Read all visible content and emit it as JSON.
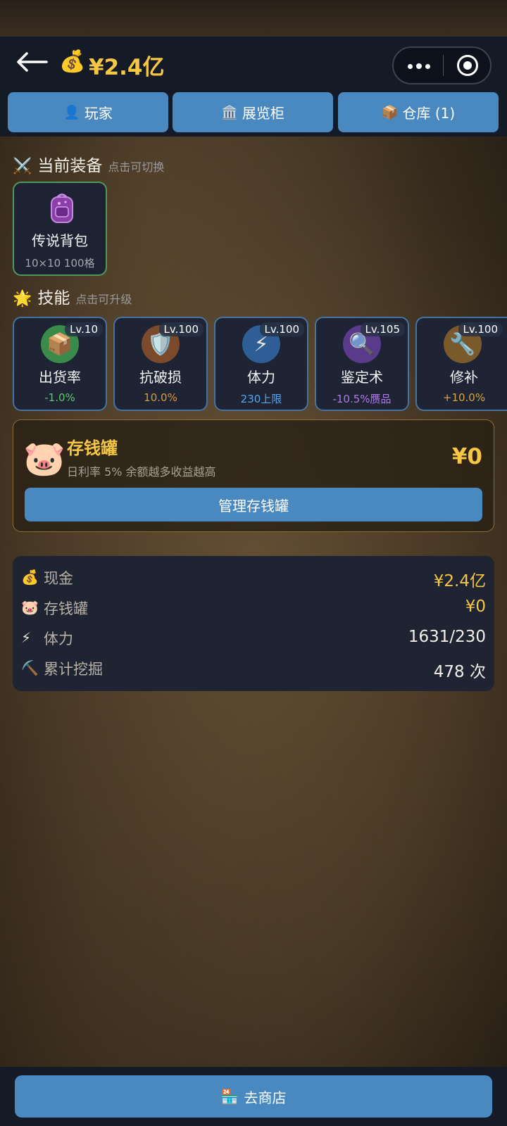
{
  "header": {
    "money_icon": "money-bag-icon",
    "money_value": "¥2.4亿"
  },
  "tabs": [
    {
      "icon": "👤",
      "label": "玩家"
    },
    {
      "icon": "🏛️",
      "label": "展览柜"
    },
    {
      "icon": "📦",
      "label": "仓库 (1)"
    }
  ],
  "equipment": {
    "title": "当前装备",
    "hint": "点击可切换",
    "item": {
      "name": "传说背包",
      "desc": "10×10 100格"
    }
  },
  "skills": {
    "title": "技能",
    "hint": "点击可升级",
    "items": [
      {
        "name": "出货率",
        "level": "Lv.10",
        "value": "-1.0%",
        "icon": "📦",
        "color": "#3a8a4a",
        "value_color": "#5ccb6a"
      },
      {
        "name": "抗破损",
        "level": "Lv.100",
        "value": "10.0%",
        "icon": "🛡️",
        "color": "#7a4a2a",
        "value_color": "#d99a3a"
      },
      {
        "name": "体力",
        "level": "Lv.100",
        "value": "230上限",
        "icon": "⚡",
        "color": "#2f5e96",
        "value_color": "#58a6ef"
      },
      {
        "name": "鉴定术",
        "level": "Lv.105",
        "value": "-10.5%赝品",
        "icon": "🔍",
        "color": "#5a3a8a",
        "value_color": "#b078e8"
      },
      {
        "name": "修补",
        "level": "Lv.100",
        "value": "+10.0%",
        "icon": "🔧",
        "color": "#7a5a2a",
        "value_color": "#d9a43a"
      }
    ]
  },
  "piggy_bank": {
    "title": "存钱罐",
    "subtitle": "日利率 5%  余额越多收益越高",
    "amount": "¥0",
    "manage_label": "管理存钱罐"
  },
  "stats": [
    {
      "icon": "💰",
      "label": "现金",
      "value": "¥2.4亿",
      "color": "#f6c744"
    },
    {
      "icon": "🐷",
      "label": "存钱罐",
      "value": "¥0",
      "color": "#f6c744"
    },
    {
      "icon": "⚡",
      "label": "体力",
      "value": "1631/230",
      "color": "#f2efe8"
    },
    {
      "icon": "⛏️",
      "label": "累计挖掘",
      "value": "478 次",
      "color": "#f2efe8"
    }
  ],
  "bottom": {
    "icon": "🏪",
    "shop_label": "去商店"
  }
}
